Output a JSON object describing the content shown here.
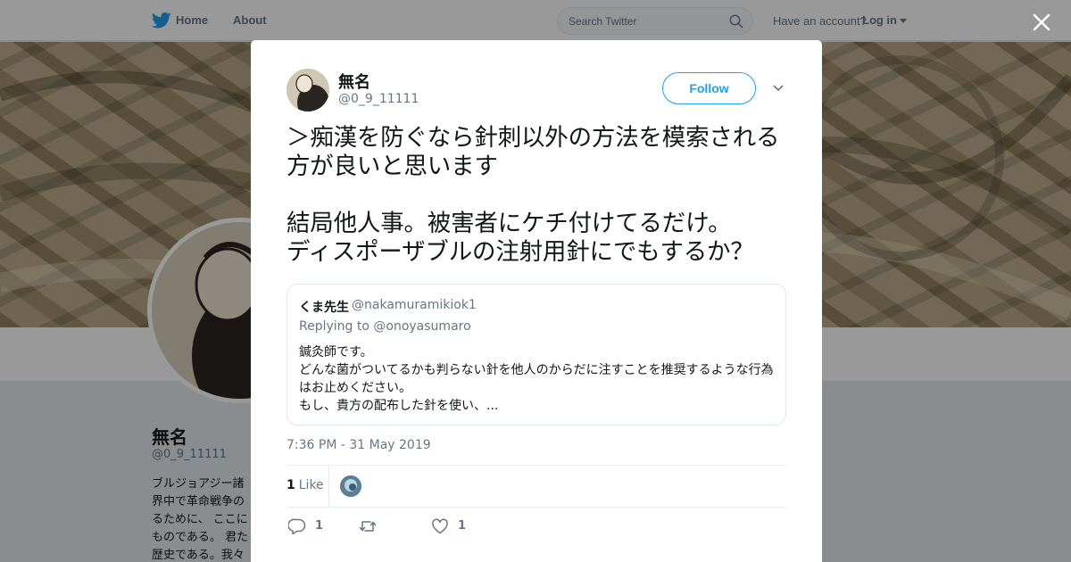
{
  "nav": {
    "home_label": "Home",
    "about_label": "About",
    "search_placeholder": "Search Twitter",
    "account_prompt": "Have an account?",
    "login_label": "Log in"
  },
  "profile": {
    "name": "無名",
    "handle": "@0_9_11111",
    "bio_visible": "ブルジョアジー諸\n界中で革命戦争の\nるために、 ここに\nものである。 君た\n歴史である。我々"
  },
  "tweet": {
    "author_name": "無名",
    "author_handle": "@0_9_11111",
    "follow_label": "Follow",
    "text": "＞痴漢を防ぐなら針刺以外の方法を模索される方が良いと思います\n\n結局他人事。被害者にケチ付けてるだけ。\nディスポーザブルの注射用針にでもするか？",
    "timestamp": "7:36 PM - 31 May 2019",
    "like_count": "1",
    "like_label": "Like",
    "reply_count": "1",
    "like_action_count": "1"
  },
  "quote": {
    "name": "くま先生",
    "handle": "@nakamuramikiok1",
    "reply_prefix": "Replying to",
    "reply_to": "@onoyasumaro",
    "body": "鍼灸師です。\nどんな菌がついてるかも判らない針を他人のからだに注すことを推奨するような行為はお止めください。\nもし、貴方の配布した針を使い、..."
  },
  "colors": {
    "accent": "#1da1f2",
    "muted": "#657786",
    "overlay": "rgba(0,0,0,0.4)"
  },
  "icons": [
    "twitter-bird-icon",
    "search-icon",
    "chevron-down-icon",
    "close-icon",
    "reply-icon",
    "retweet-icon",
    "heart-icon"
  ]
}
